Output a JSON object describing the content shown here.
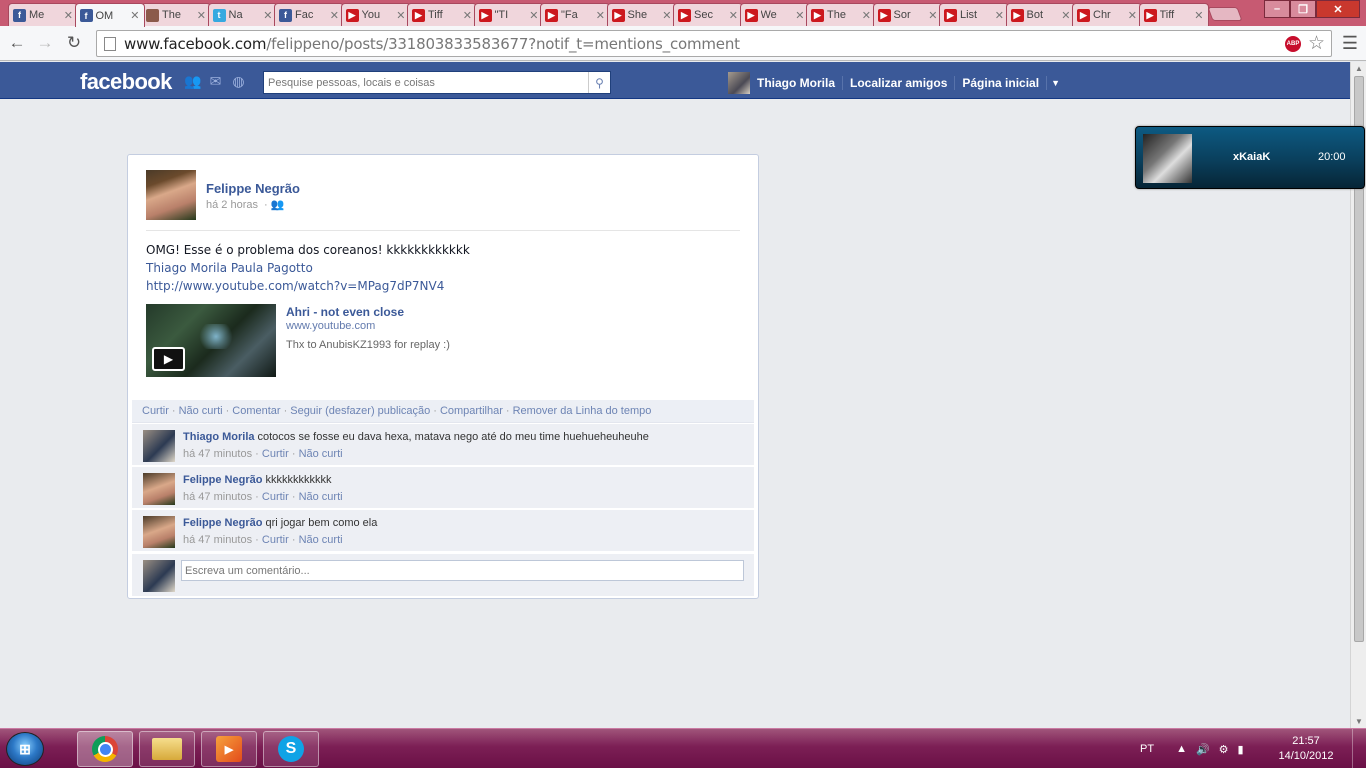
{
  "browser": {
    "tabs": [
      {
        "label": "Me",
        "icon": "f",
        "kind": "fb"
      },
      {
        "label": "OM",
        "icon": "f",
        "kind": "fb",
        "active": true
      },
      {
        "label": "The",
        "icon": "",
        "kind": "ph"
      },
      {
        "label": "Na",
        "icon": "t",
        "kind": "tw"
      },
      {
        "label": "Fac",
        "icon": "f",
        "kind": "fb"
      },
      {
        "label": "You",
        "icon": "▶",
        "kind": "yt"
      },
      {
        "label": "Tiff",
        "icon": "▶",
        "kind": "yt"
      },
      {
        "label": "\"TI",
        "icon": "▶",
        "kind": "yt"
      },
      {
        "label": "\"Fa",
        "icon": "▶",
        "kind": "yt"
      },
      {
        "label": "She",
        "icon": "▶",
        "kind": "yt"
      },
      {
        "label": "Sec",
        "icon": "▶",
        "kind": "yt"
      },
      {
        "label": "We",
        "icon": "▶",
        "kind": "yt"
      },
      {
        "label": "The",
        "icon": "▶",
        "kind": "yt"
      },
      {
        "label": "Sor",
        "icon": "▶",
        "kind": "yt"
      },
      {
        "label": "List",
        "icon": "▶",
        "kind": "yt"
      },
      {
        "label": "Bot",
        "icon": "▶",
        "kind": "yt"
      },
      {
        "label": "Chr",
        "icon": "▶",
        "kind": "yt"
      },
      {
        "label": "Tiff",
        "icon": "▶",
        "kind": "yt"
      }
    ],
    "url_domain": "www.facebook.com",
    "url_path": "/felippeno/posts/331803833583677?notif_t=mentions_comment",
    "abp_label": "ABP"
  },
  "facebook": {
    "logo": "facebook",
    "search_placeholder": "Pesquise pessoas, locais e coisas",
    "nav": {
      "user": "Thiago Morila",
      "find_friends": "Localizar amigos",
      "home": "Página inicial"
    }
  },
  "post": {
    "author": "Felippe Negrão",
    "time": "há 2 horas",
    "text": "OMG! Esse é o problema dos coreanos! kkkkkkkkkkkk",
    "tags": "Thiago Morila Paula Pagotto",
    "link": "http://www.youtube.com/watch?v=MPag7dP7NV4",
    "video": {
      "title": "Ahri - not even close",
      "domain": "www.youtube.com",
      "description": "Thx to AnubisKZ1993 for replay :)"
    },
    "actions": [
      "Curtir",
      "Não curti",
      "Comentar",
      "Seguir (desfazer) publicação",
      "Compartilhar",
      "Remover da Linha do tempo"
    ],
    "comments": [
      {
        "author": "Thiago Morila",
        "text": "cotocos se fosse eu dava hexa, matava nego até do meu time huehueheuheuhe",
        "time": "há 47 minutos",
        "like": "Curtir",
        "dislike": "Não curti"
      },
      {
        "author": "Felippe Negrão",
        "text": "kkkkkkkkkkkk",
        "time": "há 47 minutos",
        "like": "Curtir",
        "dislike": "Não curti"
      },
      {
        "author": "Felippe Negrão",
        "text": "qri jogar bem como ela",
        "time": "há 47 minutos",
        "like": "Curtir",
        "dislike": "Não curti"
      }
    ],
    "comment_placeholder": "Escreva um comentário..."
  },
  "notification": {
    "name": "xKaiaK",
    "time": "20:00"
  },
  "taskbar": {
    "lang": "PT",
    "time": "21:57",
    "date": "14/10/2012"
  }
}
